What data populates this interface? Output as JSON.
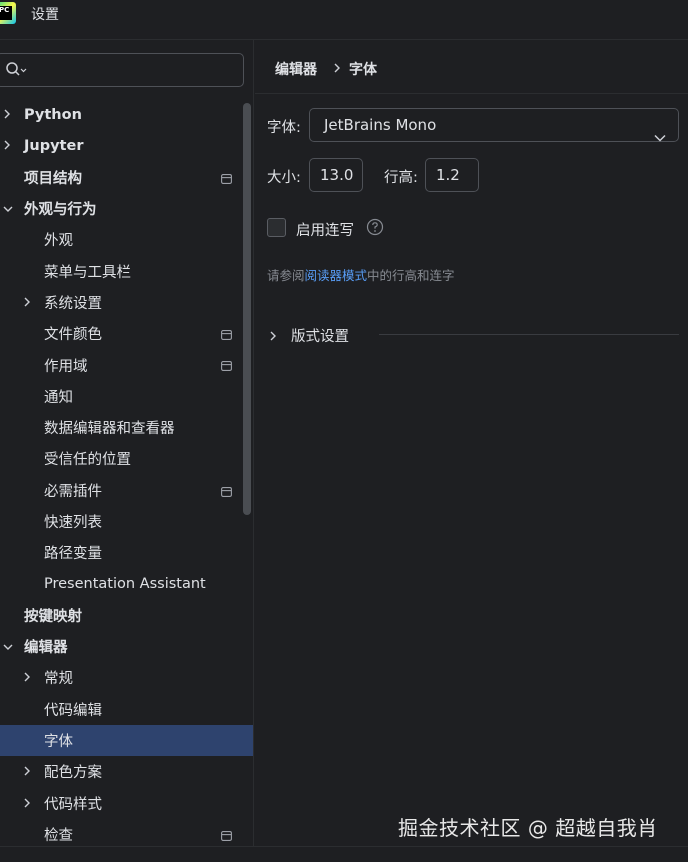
{
  "window": {
    "title": "设置",
    "logo_text": "PC"
  },
  "search": {
    "placeholder": ""
  },
  "sidebar": {
    "items": [
      {
        "label": "Python",
        "level": 0,
        "bold": true,
        "chevron": "right"
      },
      {
        "label": "Jupyter",
        "level": 0,
        "bold": true,
        "chevron": "right"
      },
      {
        "label": "项目结构",
        "level": 0,
        "bold": true,
        "chevron": "",
        "badge": true
      },
      {
        "label": "外观与行为",
        "level": 0,
        "bold": true,
        "chevron": "down"
      },
      {
        "label": "外观",
        "level": 1,
        "chevron": ""
      },
      {
        "label": "菜单与工具栏",
        "level": 1,
        "chevron": ""
      },
      {
        "label": "系统设置",
        "level": 1,
        "chevron": "right"
      },
      {
        "label": "文件颜色",
        "level": 1,
        "chevron": "",
        "badge": true
      },
      {
        "label": "作用域",
        "level": 1,
        "chevron": "",
        "badge": true
      },
      {
        "label": "通知",
        "level": 1,
        "chevron": ""
      },
      {
        "label": "数据编辑器和查看器",
        "level": 1,
        "chevron": ""
      },
      {
        "label": "受信任的位置",
        "level": 1,
        "chevron": ""
      },
      {
        "label": "必需插件",
        "level": 1,
        "chevron": "",
        "badge": true
      },
      {
        "label": "快速列表",
        "level": 1,
        "chevron": ""
      },
      {
        "label": "路径变量",
        "level": 1,
        "chevron": ""
      },
      {
        "label": "Presentation Assistant",
        "level": 1,
        "chevron": ""
      },
      {
        "label": "按键映射",
        "level": 0,
        "bold": true,
        "chevron": ""
      },
      {
        "label": "编辑器",
        "level": 0,
        "bold": true,
        "chevron": "down"
      },
      {
        "label": "常规",
        "level": 1,
        "chevron": "right"
      },
      {
        "label": "代码编辑",
        "level": 1,
        "chevron": ""
      },
      {
        "label": "字体",
        "level": 1,
        "chevron": "",
        "selected": true
      },
      {
        "label": "配色方案",
        "level": 1,
        "chevron": "right"
      },
      {
        "label": "代码样式",
        "level": 1,
        "chevron": "right"
      },
      {
        "label": "检查",
        "level": 1,
        "chevron": "",
        "badge": true
      }
    ]
  },
  "breadcrumb": {
    "parent": "编辑器",
    "current": "字体"
  },
  "font": {
    "label": "字体:",
    "value": "JetBrains Mono",
    "size_label": "大小:",
    "size_value": "13.0",
    "line_height_label": "行高:",
    "line_height_value": "1.2",
    "ligatures_label": "启用连写"
  },
  "hint": {
    "prefix": "请参阅",
    "link": "阅读器模式",
    "suffix": "中的行高和连字"
  },
  "section": {
    "label": "版式设置"
  },
  "watermark": "掘金技术社区 @ 超越自我肖",
  "colors": {
    "accent": "#2e436e",
    "link": "#589df6",
    "background": "#1e1f22"
  }
}
